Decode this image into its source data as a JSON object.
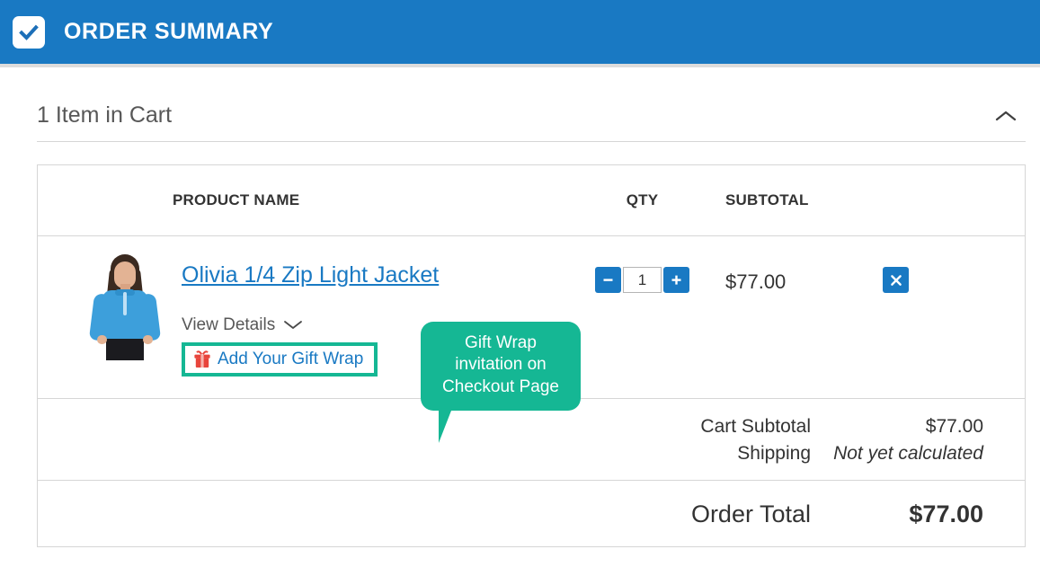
{
  "header": {
    "title": "ORDER SUMMARY",
    "check_icon": "check-badge-icon",
    "bg_color": "#1979c3"
  },
  "cart": {
    "heading": "1 Item in Cart",
    "collapse_icon": "chevron-up-icon"
  },
  "table": {
    "columns": {
      "product_name": "PRODUCT NAME",
      "qty": "QTY",
      "subtotal": "SUBTOTAL"
    },
    "rows": [
      {
        "image_alt": "product-thumbnail",
        "name": "Olivia 1/4 Zip Light Jacket",
        "view_details": "View Details",
        "view_details_icon": "chevron-down-icon",
        "gift_wrap_label": "Add Your Gift Wrap",
        "gift_wrap_icon": "gift-box-icon",
        "qty_decrement": "−",
        "qty_value": "1",
        "qty_increment": "+",
        "subtotal": "$77.00",
        "remove_icon": "close-x-icon"
      }
    ]
  },
  "totals": {
    "rows": [
      {
        "label": "Cart Subtotal",
        "value": "$77.00",
        "italic": false
      },
      {
        "label": "Shipping",
        "value": "Not yet calculated",
        "italic": true
      }
    ],
    "grand": {
      "label": "Order Total",
      "value": "$77.00"
    }
  },
  "callout": {
    "text": "Gift Wrap invitation on Checkout Page",
    "line1": "Gift Wrap",
    "line2": "invitation on",
    "line3": "Checkout Page",
    "color": "#15b794"
  },
  "colors": {
    "accent_blue": "#1979c3",
    "highlight_teal": "#15b794",
    "gift_red": "#e8453c",
    "border_gray": "#d6d6d6"
  }
}
